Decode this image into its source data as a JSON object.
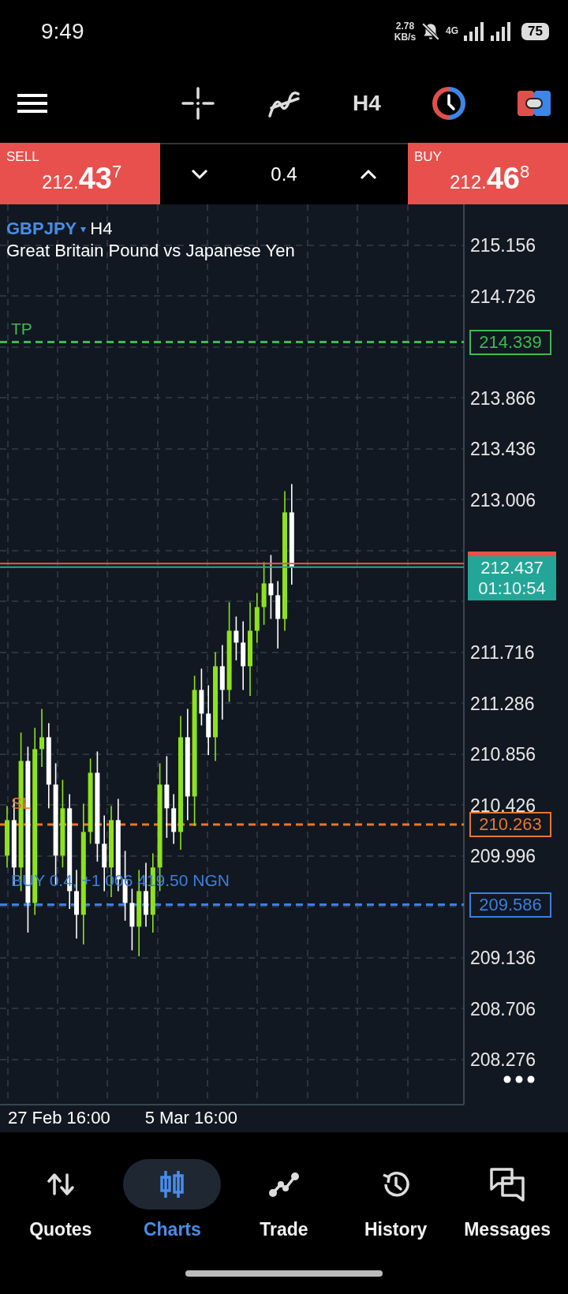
{
  "status_bar": {
    "time": "9:49",
    "speed": "2.78",
    "speed_unit": "KB/s",
    "network": "4G",
    "battery": "75"
  },
  "toolbar": {
    "timeframe": "H4"
  },
  "trade_bar": {
    "sell": {
      "label": "SELL",
      "price_small": "212.",
      "price_big": "43",
      "price_sup": "7"
    },
    "volume": "0.4",
    "buy": {
      "label": "BUY",
      "price_small": "212.",
      "price_big": "46",
      "price_sup": "8"
    }
  },
  "chart": {
    "symbol": "GBPJPY",
    "symbol_marker": "▾",
    "timeframe": "H4",
    "description": "Great Britain Pound vs Japanese Yen",
    "price_axis": [
      "215.156",
      "214.726",
      "213.866",
      "213.436",
      "213.006",
      "211.716",
      "211.286",
      "210.856",
      "210.426",
      "209.996",
      "209.136",
      "208.706",
      "208.276"
    ],
    "levels": [
      {
        "kind": "tp",
        "label": "TP",
        "price": "214.339",
        "color": "#3fb950"
      },
      {
        "kind": "sl",
        "label": "SL",
        "price": "210.263",
        "color": "#e8772e"
      },
      {
        "kind": "position",
        "label": "BUY 0.4, +1 006 419.50 NGN",
        "price": "209.586",
        "color": "#3d7fe0"
      }
    ],
    "current": {
      "price": "212.437",
      "countdown": "01:10:54"
    },
    "time_axis": [
      "27 Feb 16:00",
      "5 Mar 16:00"
    ]
  },
  "nav": [
    {
      "label": "Quotes",
      "kind": "quotes",
      "selected": false
    },
    {
      "label": "Charts",
      "kind": "charts",
      "selected": true
    },
    {
      "label": "Trade",
      "kind": "trade",
      "selected": false
    },
    {
      "label": "History",
      "kind": "history",
      "selected": false
    },
    {
      "label": "Messages",
      "kind": "messages",
      "selected": false
    }
  ]
}
